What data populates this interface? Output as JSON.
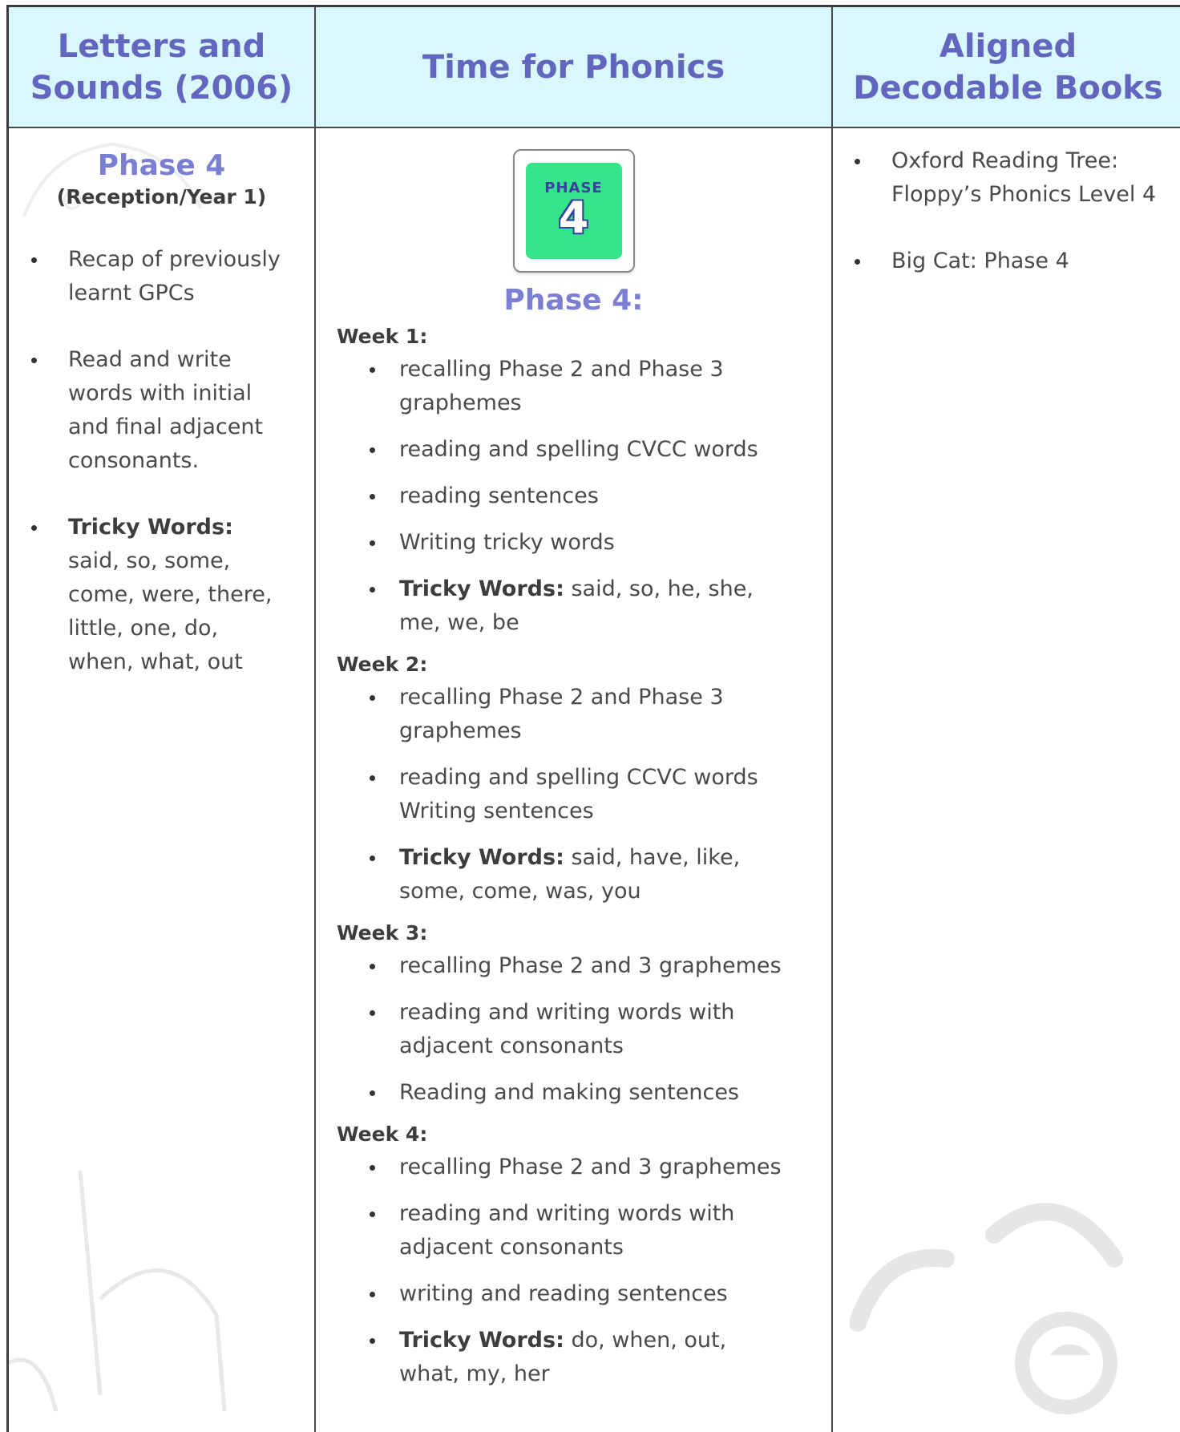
{
  "columns": {
    "col1_header": "Letters and\nSounds (2006)",
    "col2_header": "Time for Phonics",
    "col3_header": "Aligned\nDecodable Books"
  },
  "col1": {
    "phase_title": "Phase 4",
    "subtitle": "(Reception/Year 1)",
    "items": [
      {
        "text": "Recap of previously learnt GPCs"
      },
      {
        "text": "Read and write words with initial and final adjacent consonants."
      },
      {
        "bold": "Tricky Words:",
        "text": " said, so, some, come, were, there, little, one, do, when, what, out"
      }
    ]
  },
  "col2": {
    "badge": {
      "word": "PHASE",
      "number": "4"
    },
    "phase_title": "Phase 4:",
    "weeks": [
      {
        "label": "Week 1:",
        "items": [
          {
            "text": "recalling Phase 2 and Phase 3 graphemes"
          },
          {
            "text": "reading and spelling CVCC words"
          },
          {
            "text": "reading sentences"
          },
          {
            "text": "Writing tricky words"
          },
          {
            "bold": "Tricky Words:",
            "text": " said, so, he, she, me, we, be"
          }
        ]
      },
      {
        "label": "Week 2:",
        "items": [
          {
            "text": "recalling Phase 2 and Phase 3 graphemes"
          },
          {
            "text": "reading and spelling CCVC words Writing sentences"
          },
          {
            "bold": "Tricky Words:",
            "text": " said, have, like, some, come, was, you"
          }
        ]
      },
      {
        "label": "Week 3:",
        "items": [
          {
            "text": "recalling Phase 2 and 3 graphemes"
          },
          {
            "text": "reading and writing words with adjacent consonants"
          },
          {
            "text": "Reading and making sentences"
          }
        ]
      },
      {
        "label": "Week 4:",
        "items": [
          {
            "text": "recalling Phase 2 and 3 graphemes"
          },
          {
            "text": "reading and writing words with adjacent consonants"
          },
          {
            "text": "writing and reading sentences"
          },
          {
            "bold": "Tricky Words:",
            "text": " do, when, out, what, my, her"
          }
        ]
      }
    ]
  },
  "col3": {
    "items": [
      {
        "text": "Oxford Reading Tree: Floppy’s Phonics Level 4"
      },
      {
        "text": "Big Cat: Phase 4"
      }
    ]
  },
  "colors": {
    "header_bg": "#d9f8fd",
    "header_text": "#6266bf",
    "phase_title": "#7b7fd3",
    "badge_green": "#35e58a"
  }
}
